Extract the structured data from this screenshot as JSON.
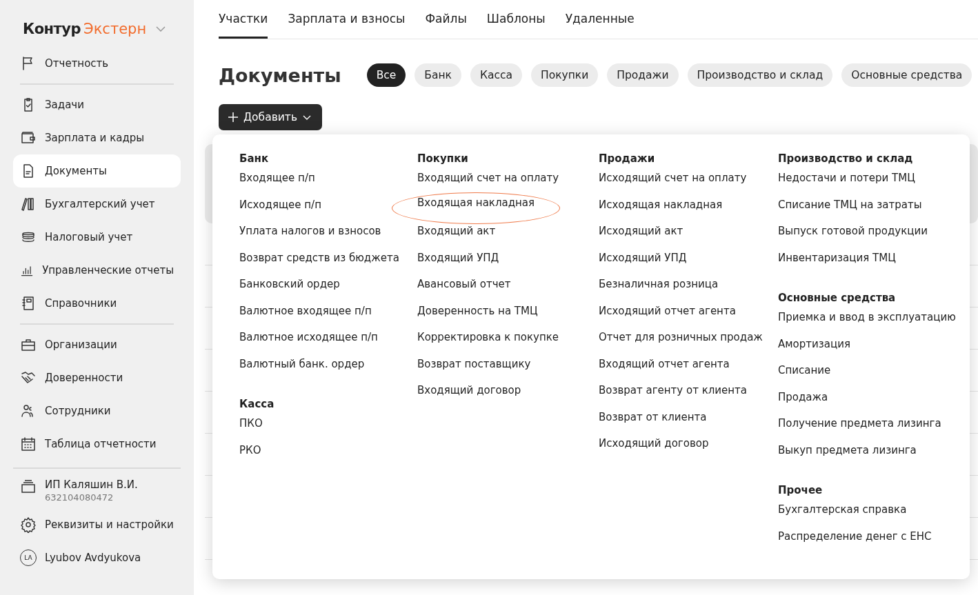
{
  "sidebar": {
    "logo": {
      "brand": "Контур",
      "product": "Экстерн"
    },
    "groups": [
      [
        {
          "label": "Отчетность",
          "selected": false
        }
      ],
      [
        {
          "label": "Задачи",
          "selected": false
        },
        {
          "label": "Зарплата и кадры",
          "selected": false
        },
        {
          "label": "Документы",
          "selected": true
        },
        {
          "label": "Бухгалтерский учет",
          "selected": false
        },
        {
          "label": "Налоговый учет",
          "selected": false
        },
        {
          "label": "Управленческие отчеты",
          "selected": false
        },
        {
          "label": "Справочники",
          "selected": false
        }
      ],
      [
        {
          "label": "Организации",
          "selected": false
        },
        {
          "label": "Доверенности",
          "selected": false
        },
        {
          "label": "Сотрудники",
          "selected": false
        },
        {
          "label": "Таблица отчетности",
          "selected": false
        }
      ]
    ],
    "organization": {
      "name": "ИП Каляшин В.И.",
      "inn": "632104080472"
    },
    "settings": "Реквизиты и настройки",
    "user": {
      "initials": "LA",
      "name": "Lyubov Avdyukova"
    }
  },
  "tabs": [
    {
      "label": "Участки",
      "selected": true
    },
    {
      "label": "Зарплата и взносы",
      "selected": false
    },
    {
      "label": "Файлы",
      "selected": false
    },
    {
      "label": "Шаблоны",
      "selected": false
    },
    {
      "label": "Удаленные",
      "selected": false
    }
  ],
  "page_title": "Документы",
  "filters": [
    {
      "label": "Все",
      "selected": true
    },
    {
      "label": "Банк",
      "selected": false
    },
    {
      "label": "Касса",
      "selected": false
    },
    {
      "label": "Покупки",
      "selected": false
    },
    {
      "label": "Продажи",
      "selected": false
    },
    {
      "label": "Производство и склад",
      "selected": false
    },
    {
      "label": "Основные средства",
      "selected": false
    }
  ],
  "add_button": "Добавить",
  "menu": {
    "columns": [
      {
        "groups": [
          {
            "title": "Банк",
            "items": [
              {
                "label": "Входящее п/п",
                "circled": false
              },
              {
                "label": "Исходящее п/п",
                "circled": false
              },
              {
                "label": "Уплата налогов и взносов",
                "circled": false
              },
              {
                "label": "Возврат средств из бюджета",
                "circled": false
              },
              {
                "label": "Банковский ордер",
                "circled": false
              },
              {
                "label": "Валютное входящее п/п",
                "circled": false
              },
              {
                "label": "Валютное исходящее п/п",
                "circled": false
              },
              {
                "label": "Валютный банк. ордер",
                "circled": false
              }
            ]
          },
          {
            "title": "Касса",
            "items": [
              {
                "label": "ПКО",
                "circled": false
              },
              {
                "label": "РКО",
                "circled": false
              }
            ]
          }
        ]
      },
      {
        "groups": [
          {
            "title": "Покупки",
            "items": [
              {
                "label": "Входящий счет на оплату",
                "circled": false
              },
              {
                "label": "Входящая накладная",
                "circled": true
              },
              {
                "label": "Входящий акт",
                "circled": false
              },
              {
                "label": "Входящий УПД",
                "circled": false
              },
              {
                "label": "Авансовый отчет",
                "circled": false
              },
              {
                "label": "Доверенность на ТМЦ",
                "circled": false
              },
              {
                "label": "Корректировка к покупке",
                "circled": false
              },
              {
                "label": "Возврат поставщику",
                "circled": false
              },
              {
                "label": "Входящий договор",
                "circled": false
              }
            ]
          }
        ]
      },
      {
        "groups": [
          {
            "title": "Продажи",
            "items": [
              {
                "label": "Исходящий счет на оплату",
                "circled": false
              },
              {
                "label": "Исходящая накладная",
                "circled": false
              },
              {
                "label": "Исходящий акт",
                "circled": false
              },
              {
                "label": "Исходящий УПД",
                "circled": false
              },
              {
                "label": "Безналичная розница",
                "circled": false
              },
              {
                "label": "Исходящий отчет агента",
                "circled": false
              },
              {
                "label": "Отчет для розничных продаж",
                "circled": false
              },
              {
                "label": "Входящий отчет агента",
                "circled": false
              },
              {
                "label": "Возврат агенту от клиента",
                "circled": false
              },
              {
                "label": "Возврат от клиента",
                "circled": false
              },
              {
                "label": "Исходящий договор",
                "circled": false
              }
            ]
          }
        ]
      },
      {
        "groups": [
          {
            "title": "Производство и склад",
            "items": [
              {
                "label": "Недостачи и потери ТМЦ",
                "circled": false
              },
              {
                "label": "Списание ТМЦ на затраты",
                "circled": false
              },
              {
                "label": "Выпуск готовой продукции",
                "circled": false
              },
              {
                "label": "Инвентаризация ТМЦ",
                "circled": false
              }
            ]
          },
          {
            "title": "Основные средства",
            "items": [
              {
                "label": "Приемка и ввод в эксплуатацию",
                "circled": false
              },
              {
                "label": "Амортизация",
                "circled": false
              },
              {
                "label": "Списание",
                "circled": false
              },
              {
                "label": "Продажа",
                "circled": false
              },
              {
                "label": "Получение предмета лизинга",
                "circled": false
              },
              {
                "label": "Выкуп предмета лизинга",
                "circled": false
              }
            ]
          },
          {
            "title": "Прочее",
            "items": [
              {
                "label": "Бухгалтерская справка",
                "circled": false
              },
              {
                "label": "Распределение денег с ЕНС",
                "circled": false
              }
            ]
          }
        ]
      }
    ]
  }
}
